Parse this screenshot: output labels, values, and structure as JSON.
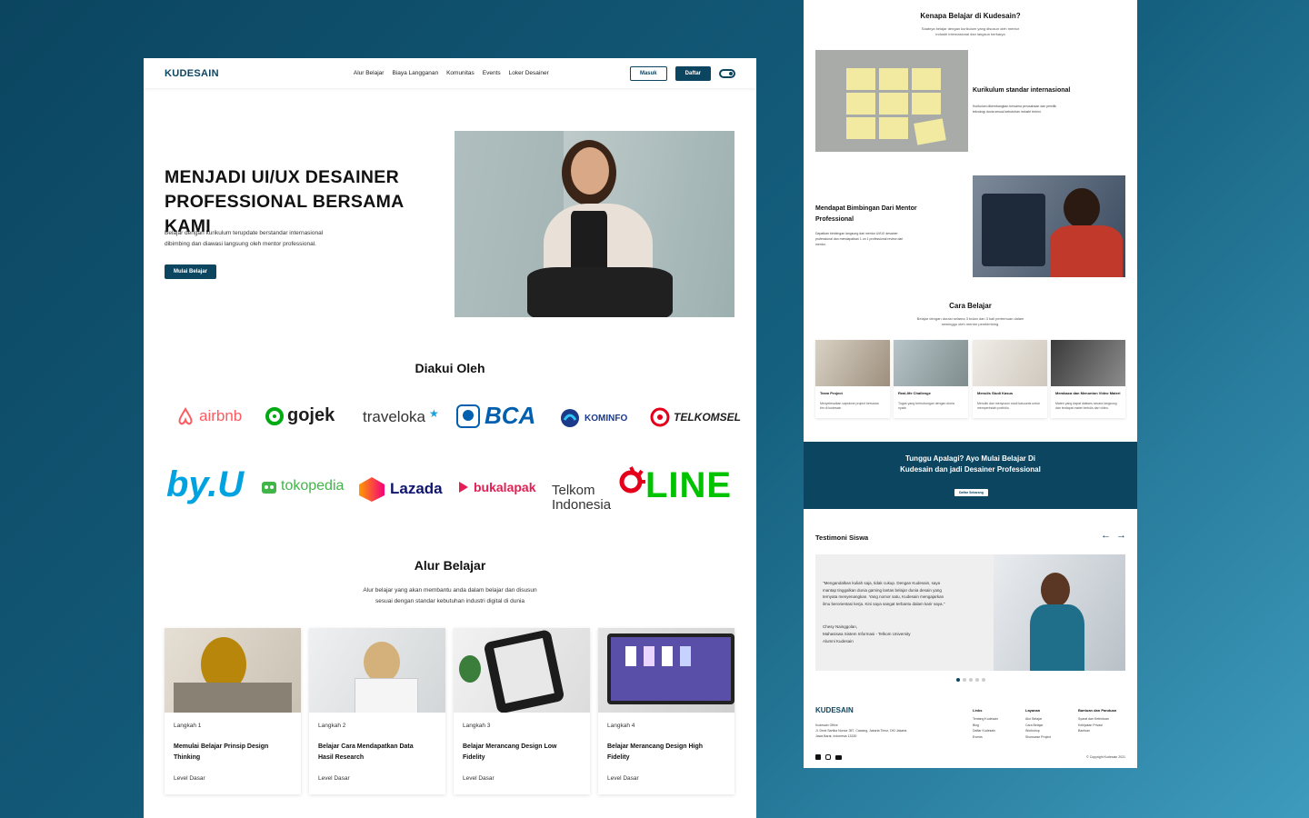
{
  "brand": "KUDESAIN",
  "nav": {
    "items": [
      "Alur Belajar",
      "Biaya Langganan",
      "Komunitas",
      "Events",
      "Loker Desainer"
    ],
    "login": "Masuk",
    "register": "Daftar"
  },
  "hero": {
    "title_line1": "MENJADI UI/UX DESAINER",
    "title_line2": "PROFESSIONAL BERSAMA KAMI",
    "subtitle_line1": "Belajar dengan kurikulum terupdate berstandar internasional",
    "subtitle_line2": "dibimbing dan diawasi langsung oleh mentor professional.",
    "cta": "Mulai Belajar"
  },
  "recognized": {
    "title": "Diakui Oleh",
    "brands": [
      "airbnb",
      "gojek",
      "traveloka",
      "BCA",
      "KOMINFO",
      "TELKOMSEL",
      "by.U",
      "tokopedia",
      "Lazada",
      "bukalapak",
      "Telkom",
      "Indonesia",
      "LINE"
    ]
  },
  "flow": {
    "title": "Alur Belajar",
    "subtitle_line1": "Alur belajar yang akan membantu anda dalam belajar dan disusun",
    "subtitle_line2": "sesuai dengan standar kebutuhan industri digital di dunia",
    "cards": [
      {
        "step": "Langkah 1",
        "title": "Memulai Belajar Prinsip Design Thinking",
        "level": "Level Dasar"
      },
      {
        "step": "Langkah 2",
        "title": "Belajar Cara Mendapatkan Data Hasil Research",
        "level": "Level Dasar"
      },
      {
        "step": "Langkah 3",
        "title": "Belajar Merancang Design Low Fidelity",
        "level": "Level Dasar"
      },
      {
        "step": "Langkah 4",
        "title": "Belajar Merancang Design High Fidelity",
        "level": "Level Dasar"
      }
    ]
  },
  "why": {
    "title": "Kenapa Belajar di Kudesain?",
    "subtitle_line1": "Saatnya belajar dengan kurikulum yang disusun oleh mentor",
    "subtitle_line2": "industri internasional dan langsun berkarya",
    "f1_title": "Kurikulum standar internasional",
    "f1_desc_line1": "Kurikulum dikembangkan bersama perusahaan dan pemilik",
    "f1_desc_line2": "teknologi dunia sesuai kebutuhan industri terkini.",
    "f2_title_line1": "Mendapat Bimbingan Dari Mentor",
    "f2_title_line2": "Professional",
    "f2_desc_line1": "Dapatkan bimbingan langsung dari mentor UI/UX desainer",
    "f2_desc_line2": "professional dan mendapatkan 1 on 1 professional review dari",
    "f2_desc_line3": "mentor."
  },
  "how": {
    "title": "Cara Belajar",
    "subtitle_line1": "Belajar dengan durasi selama 3 bulan dan 3 kali pertemuan dalam",
    "subtitle_line2": "seminggu oleh mentor pembimbing.",
    "items": [
      {
        "title": "Team Project",
        "desc": "Menyelesaikan capstone project bersama tim di kudesain"
      },
      {
        "title": "Real-life Challenge",
        "desc": "Tugas yang berhubungan dengan dunia nyata"
      },
      {
        "title": "Menulis Studi Kasus",
        "desc": "Menulis dan menyusun studi kasuunts untuk memperindah portfolio."
      },
      {
        "title": "Membaca dan Menonton Video Materi",
        "desc": "Materi yang dapat diakses secara langsung dan terdapat materi tertulis dan video."
      }
    ]
  },
  "banner": {
    "line1": "Tunggu Apalagi? Ayo Mulai Belajar Di",
    "line2": "Kudesain dan jadi Desainer Professional",
    "button": "Daftar Sekarang"
  },
  "testimony": {
    "title": "Testimoni Siswa",
    "quote_line1": "\"Mengandalkan kuliah saja, tidak cukup. Dengan Kudesain, saya",
    "quote_line2": "mantap tinggalkan dunia gaming lantas belajar dunia desain yang",
    "quote_line3": "ternyata menyenangkan. Yang nomor satu, Kudesain mengajarkan",
    "quote_line4": "ilmu berorientasi kerja. Kini saya sangat terbantu dalam karir saya.\"",
    "name": "Chesy Nainggolan,",
    "major": "Mahasiswa Sistem Informasi - Telkom University",
    "role": "Alumni Kudesain"
  },
  "footer": {
    "office_title": "Kudesain Office",
    "address_line1": "Jl. Dewi Sartika Nomor 357, Cawang, Jakarta Timur, DKI Jakarta",
    "address_line2": "Jawa Barat, Indonesia 13330",
    "col1": {
      "title": "Links",
      "items": [
        "Tentang Kudesain",
        "Blog",
        "Daftar Kudesain",
        "Events"
      ]
    },
    "col2": {
      "title": "Layanan",
      "items": [
        "Alur Belajar",
        "Cara Belajar",
        "Workshop",
        "Showcase Project"
      ]
    },
    "col3": {
      "title": "Bantuan dan Panduan",
      "items": [
        "Syarat dan Ketentuan",
        "Kebijakan Privasi",
        "Bantuan"
      ]
    },
    "copyright": "© Copyright Kudesain 2021"
  },
  "colors": {
    "primary": "#0b4560"
  }
}
